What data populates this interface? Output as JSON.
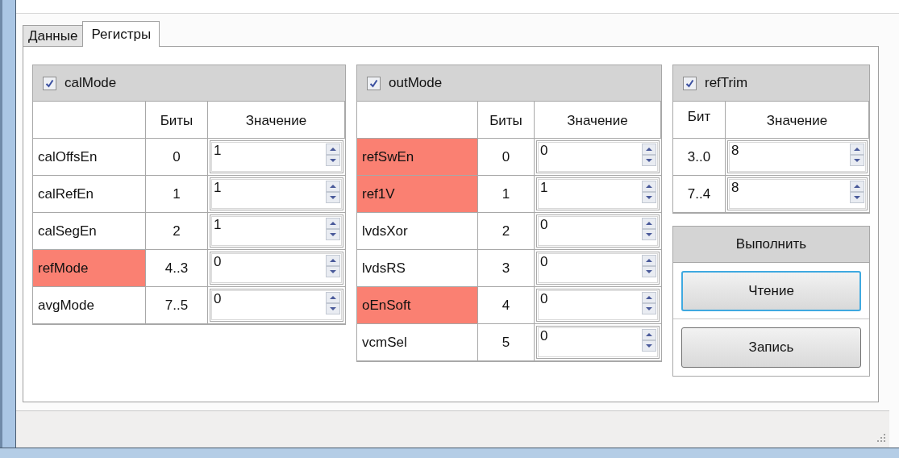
{
  "tabs": [
    {
      "label": "Данные",
      "selected": false
    },
    {
      "label": "Регистры",
      "selected": true
    }
  ],
  "groups": [
    {
      "kind": "named",
      "title": "calMode",
      "checked": true,
      "columns": [
        "Биты",
        "Значение"
      ],
      "rows": [
        {
          "name": "calOffsEn",
          "bits": "0",
          "value": "1",
          "highlighted": false
        },
        {
          "name": "calRefEn",
          "bits": "1",
          "value": "1",
          "highlighted": false
        },
        {
          "name": "calSegEn",
          "bits": "2",
          "value": "1",
          "highlighted": false
        },
        {
          "name": "refMode",
          "bits": "4..3",
          "value": "0",
          "highlighted": true
        },
        {
          "name": "avgMode",
          "bits": "7..5",
          "value": "0",
          "highlighted": false
        }
      ]
    },
    {
      "kind": "named",
      "title": "outMode",
      "checked": true,
      "columns": [
        "Биты",
        "Значение"
      ],
      "rows": [
        {
          "name": "refSwEn",
          "bits": "0",
          "value": "0",
          "highlighted": true
        },
        {
          "name": "ref1V",
          "bits": "1",
          "value": "1",
          "highlighted": true
        },
        {
          "name": "lvdsXor",
          "bits": "2",
          "value": "0",
          "highlighted": false
        },
        {
          "name": "lvdsRS",
          "bits": "3",
          "value": "0",
          "highlighted": false
        },
        {
          "name": "oEnSoft",
          "bits": "4",
          "value": "0",
          "highlighted": true
        },
        {
          "name": "vcmSel",
          "bits": "5",
          "value": "0",
          "highlighted": false
        }
      ]
    },
    {
      "kind": "bits_only",
      "title": "refTrim",
      "checked": true,
      "columns": [
        "Бит",
        "Значение"
      ],
      "rows": [
        {
          "bits": "3..0",
          "value": "8"
        },
        {
          "bits": "7..4",
          "value": "8"
        }
      ]
    }
  ],
  "actions": {
    "title": "Выполнить",
    "buttons": [
      {
        "label": "Чтение",
        "focused": true
      },
      {
        "label": "Запись",
        "focused": false
      }
    ]
  }
}
